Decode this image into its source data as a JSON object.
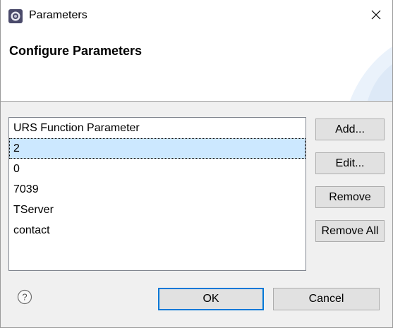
{
  "window": {
    "title": "Parameters",
    "icon": "gear-app-icon",
    "close_icon": "close-icon"
  },
  "banner": {
    "title": "Configure Parameters"
  },
  "list": {
    "items": [
      {
        "label": "URS Function Parameter",
        "selected": false
      },
      {
        "label": "2",
        "selected": true
      },
      {
        "label": "0",
        "selected": false
      },
      {
        "label": "7039",
        "selected": false
      },
      {
        "label": "TServer",
        "selected": false
      },
      {
        "label": "contact",
        "selected": false
      }
    ]
  },
  "buttons": {
    "add_label": "Add...",
    "edit_label": "Edit...",
    "remove_label": "Remove",
    "remove_all_label": "Remove All",
    "ok_label": "OK",
    "cancel_label": "Cancel",
    "help_icon": "help-icon"
  },
  "colors": {
    "selection": "#cce8ff",
    "default_button_border": "#0078d7",
    "button_bg": "#e1e1e1"
  }
}
